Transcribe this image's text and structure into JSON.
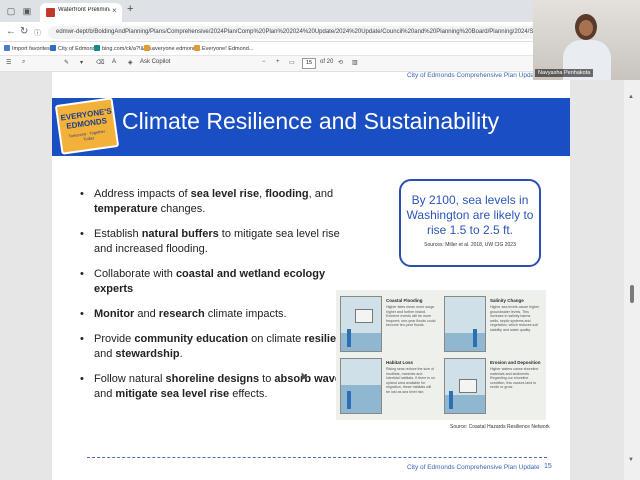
{
  "browser": {
    "tab_title": "Waterfront Preliminary Commun...",
    "new_tab_label": "+",
    "close_label": "×",
    "url": "edmwr-dept/b/BoldingAndPlanning/Plans/Comprehensive/2024Plan/Comp%20Plan%202024%20Update/2024%20Update/Council%20and%20Planning%20Board/Planning/2024/Sept/Waterfront%20Preli..."
  },
  "favorites": [
    {
      "label": "Import favorites",
      "color": "#4a7bd0"
    },
    {
      "label": "City of Edmonds",
      "color": "#2d6cc0"
    },
    {
      "label": "bing.com/ck/a?!&&p...",
      "color": "#0d8a8a"
    },
    {
      "label": "everyone edmonds...",
      "color": "#e39b2d"
    },
    {
      "label": "Everyone! Edmond...",
      "color": "#e39b2d"
    }
  ],
  "pdf_toolbar": {
    "copilot_label": "Ask Copilot",
    "minus_label": "−",
    "plus_label": "+",
    "page_current": "15",
    "page_total": "of 20"
  },
  "slide": {
    "footer": "City of Edmonds Comprehensive Plan Update",
    "logo_text": "EVERYONE'S EDMONDS",
    "logo_tag": "Tomorrow · Together · Today",
    "title": "Climate Resilience and Sustainability",
    "bullets": [
      [
        {
          "t": "Address impacts of ",
          "b": false
        },
        {
          "t": "sea level rise",
          "b": true
        },
        {
          "t": ", ",
          "b": false
        },
        {
          "t": "flooding",
          "b": true
        },
        {
          "t": ", and ",
          "b": false
        },
        {
          "t": "temperature",
          "b": true
        },
        {
          "t": " changes.",
          "b": false
        }
      ],
      [
        {
          "t": "Establish ",
          "b": false
        },
        {
          "t": "natural buffers",
          "b": true
        },
        {
          "t": " to mitigate sea level rise and increased flooding.",
          "b": false
        }
      ],
      [
        {
          "t": "Collaborate with ",
          "b": false
        },
        {
          "t": "coastal and wetland ecology experts",
          "b": true
        }
      ],
      [
        {
          "t": "Monitor",
          "b": true
        },
        {
          "t": " and ",
          "b": false
        },
        {
          "t": "research",
          "b": true
        },
        {
          "t": " climate impacts.",
          "b": false
        }
      ],
      [
        {
          "t": "Provide ",
          "b": false
        },
        {
          "t": "community education",
          "b": true
        },
        {
          "t": " on climate ",
          "b": false
        },
        {
          "t": "resilience",
          "b": true
        },
        {
          "t": " and ",
          "b": false
        },
        {
          "t": "stewardship",
          "b": true
        },
        {
          "t": ".",
          "b": false
        }
      ],
      [
        {
          "t": "Follow natural ",
          "b": false
        },
        {
          "t": "shoreline designs",
          "b": true
        },
        {
          "t": " to ",
          "b": false
        },
        {
          "t": "absorb waves",
          "b": true
        },
        {
          "t": " and ",
          "b": false
        },
        {
          "t": "mitigate sea level rise",
          "b": true
        },
        {
          "t": " effects.",
          "b": false
        }
      ]
    ],
    "callout_main": "By 2100, sea levels in Washington are likely to rise 1.5 to 2.5 ft.",
    "callout_source": "Sources: Miller et al. 2018, UW CIG 2023",
    "hazards": [
      {
        "title": "Coastal Flooding",
        "desc": "Higher tides mean more surge higher and further inland. Extreme events will be more frequent; one-year floods could become ten-year floods."
      },
      {
        "title": "Salinity Change",
        "desc": "Higher sea levels cause higher groundwater levels. This increase in salinity harms wells, septic systems and vegetation, which reduces soil stability and water quality."
      },
      {
        "title": "Habitat Loss",
        "desc": "Rising seas reduce the size of mudflats, marshes and intertidal habitats. If there is no upland area available for migration, these habitats will be lost as sea level rise."
      },
      {
        "title": "Erosion and Deposition",
        "desc": "Higher waters cause shoreline materials and sediments. Regarding our shoreline condition, this causes land to erode or grow."
      }
    ],
    "hazard_source": "Source: Coastal Hazards Resilience Network",
    "page_number": "15"
  },
  "video": {
    "participant_name": "Navyasha Penhakota"
  }
}
